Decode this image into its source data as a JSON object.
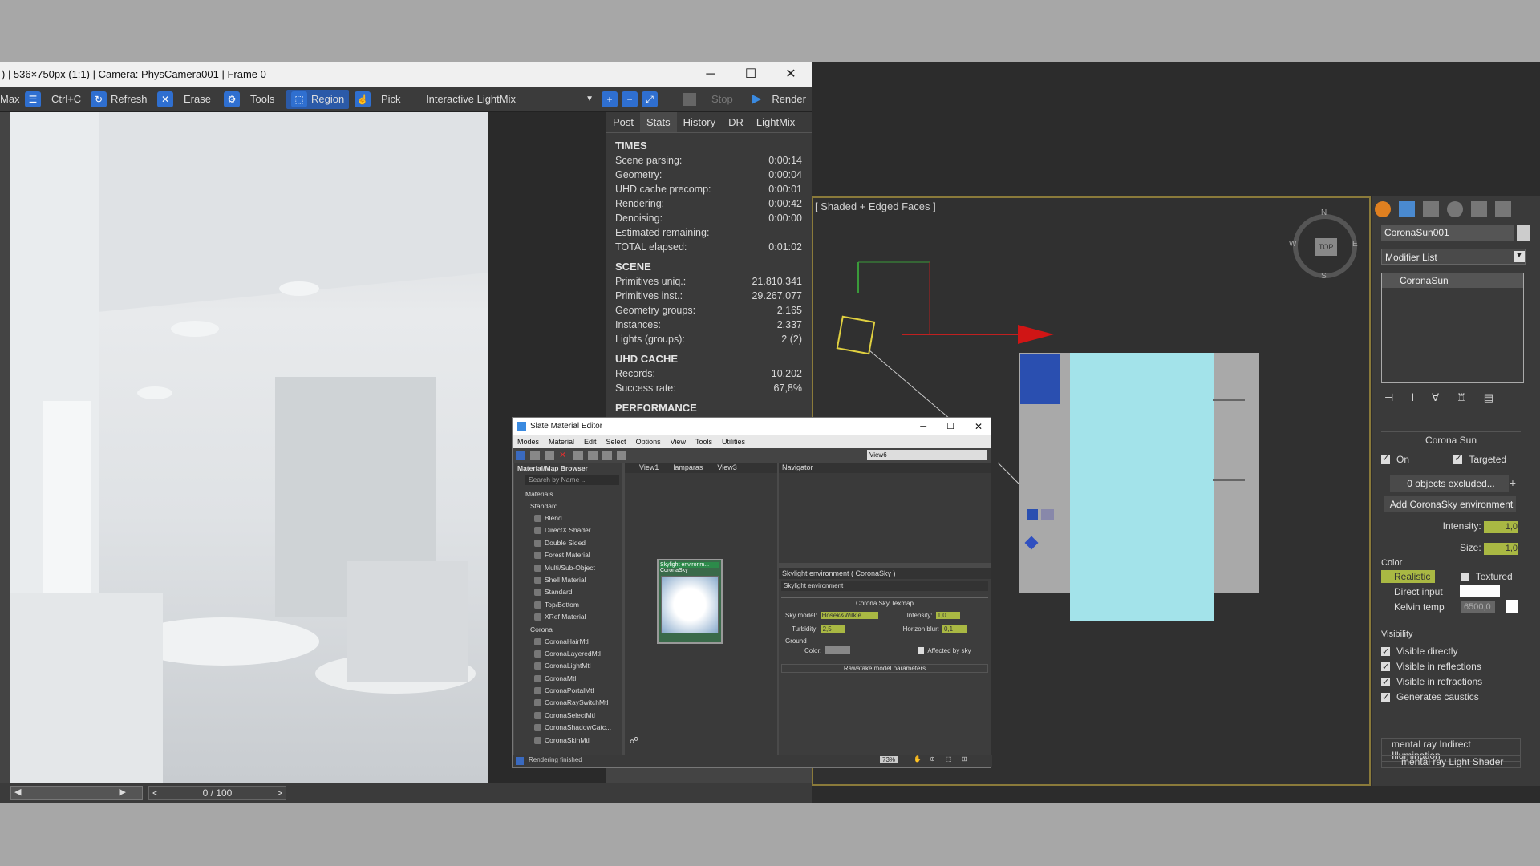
{
  "vfb": {
    "title": ") | 536×750px (1:1) | Camera: PhysCamera001 | Frame 0",
    "toolbar": {
      "max": "Max",
      "ctrlc": "Ctrl+C",
      "refresh": "Refresh",
      "erase": "Erase",
      "tools": "Tools",
      "region": "Region",
      "pick": "Pick",
      "lightmix": "Interactive LightMix",
      "stop": "Stop",
      "render": "Render"
    },
    "tabs": [
      "Post",
      "Stats",
      "History",
      "DR",
      "LightMix"
    ],
    "times_header": "TIMES",
    "times": [
      [
        "Scene parsing:",
        "0:00:14"
      ],
      [
        "Geometry:",
        "0:00:04"
      ],
      [
        "UHD cache precomp:",
        "0:00:01"
      ],
      [
        "Rendering:",
        "0:00:42"
      ],
      [
        "Denoising:",
        "0:00:00"
      ],
      [
        "Estimated remaining:",
        "---"
      ],
      [
        "TOTAL elapsed:",
        "0:01:02"
      ]
    ],
    "scene_header": "SCENE",
    "scene": [
      [
        "Primitives uniq.:",
        "21.810.341"
      ],
      [
        "Primitives inst.:",
        "29.267.077"
      ],
      [
        "Geometry groups:",
        "2.165"
      ],
      [
        "Instances:",
        "2.337"
      ],
      [
        "Lights (groups):",
        "2 (2)"
      ]
    ],
    "uhd_header": "UHD CACHE",
    "uhd": [
      [
        "Records:",
        "10.202"
      ],
      [
        "Success rate:",
        "67,8%"
      ]
    ],
    "perf_header": "PERFORMANCE",
    "pager": "0 / 100"
  },
  "slate": {
    "title": "Slate Material Editor",
    "menu": [
      "Modes",
      "Material",
      "Edit",
      "Select",
      "Options",
      "View",
      "Tools",
      "Utilities"
    ],
    "view_select": "View6",
    "browser_title": "Material/Map Browser",
    "search": "Search by Name ...",
    "materials": "Materials",
    "standard": "Standard",
    "std_items": [
      "Blend",
      "DirectX Shader",
      "Double Sided",
      "Forest Material",
      "Multi/Sub-Object",
      "Shell Material",
      "Standard",
      "Top/Bottom",
      "XRef Material"
    ],
    "corona": "Corona",
    "corona_items": [
      "CoronaHairMtl",
      "CoronaLayeredMtl",
      "CoronaLightMtl",
      "CoronaMtl",
      "CoronaPortalMtl",
      "CoronaRaySwitchMtl",
      "CoronaSelectMtl",
      "CoronaShadowCatc...",
      "CoronaSkinMtl"
    ],
    "view_tabs": [
      "View1",
      "lamparas",
      "View3"
    ],
    "node_title": "Skylight environm...",
    "node_sub": "CoronaSky",
    "navigator": "Navigator",
    "props_title": "Skylight environment  ( CoronaSky )",
    "props_name": "Skylight environment",
    "rollout": "Corona Sky Texmap",
    "sky_model_label": "Sky model:",
    "sky_model": "Hosek&Wilkie",
    "intensity_label": "Intensity:",
    "intensity": "1,0",
    "turbidity_label": "Turbidity:",
    "turbidity": "2,5",
    "horizon_label": "Horizon blur:",
    "horizon": "0,1",
    "ground": "Ground",
    "color_label": "Color:",
    "affected": "Affected by sky",
    "rawafake": "Rawafake model parameters",
    "status": "Rendering finished",
    "zoom": "73%"
  },
  "viewport": {
    "label": "[ Shaded + Edged Faces ]",
    "cube": "TOP",
    "n": "N",
    "s": "S",
    "e": "E",
    "w": "W"
  },
  "cmd": {
    "name": "CoronaSun001",
    "modifier_list": "Modifier List",
    "stack_item": "CoronaSun",
    "rollout": "Corona Sun",
    "on": "On",
    "targeted": "Targeted",
    "excluded": "0 objects excluded...",
    "plus": "+",
    "add_sky": "Add CoronaSky environment",
    "intensity_label": "Intensity:",
    "intensity": "1,0",
    "size_label": "Size:",
    "size": "1,0",
    "color": "Color",
    "realistic": "Realistic",
    "textured": "Textured",
    "direct": "Direct input",
    "kelvin": "Kelvin temp",
    "kelvin_val": "6500,0",
    "visibility": "Visibility",
    "vis_items": [
      "Visible directly",
      "Visible in reflections",
      "Visible in refractions",
      "Generates caustics"
    ],
    "mr_indirect": "mental ray Indirect Illumination",
    "mr_shader": "mental ray Light Shader"
  }
}
